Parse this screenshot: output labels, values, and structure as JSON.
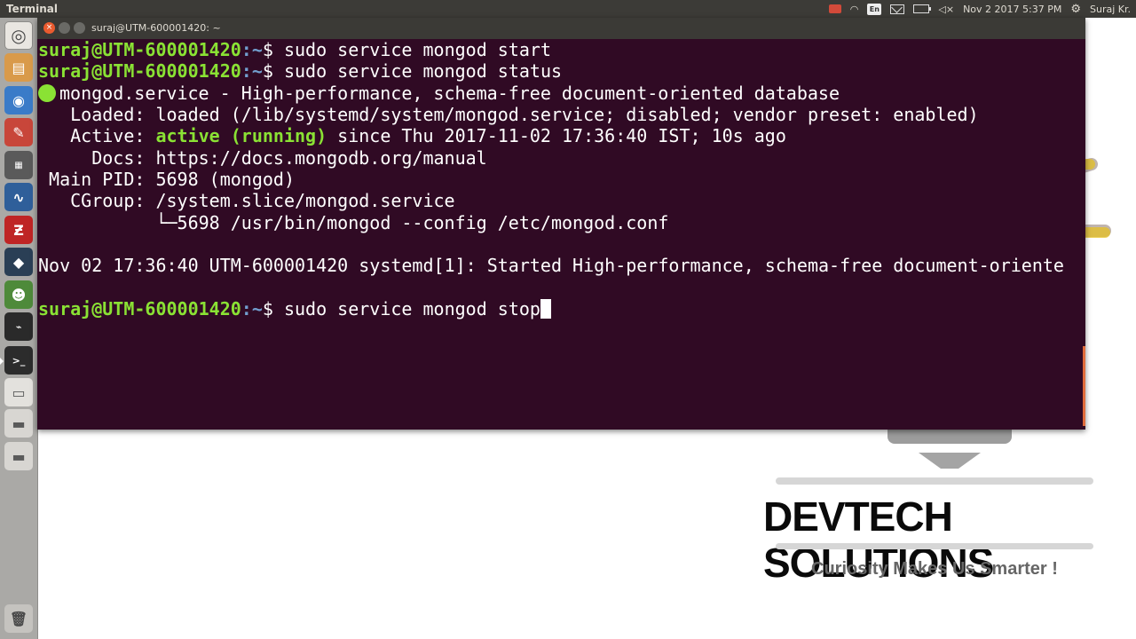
{
  "top_panel": {
    "app_name": "Terminal",
    "keyboard_layout": "En",
    "datetime": "Nov 2 2017 5:37 PM",
    "user": "Suraj Kr."
  },
  "launcher": {
    "items": [
      "dash-home",
      "files",
      "chromium",
      "tools",
      "virtualbox",
      "monitor",
      "filezilla",
      "network",
      "android-studio",
      "system-monitor",
      "terminal",
      "app",
      "drive",
      "drive",
      "trash"
    ]
  },
  "terminal": {
    "title": "suraj@UTM-600001420: ~",
    "prompt_user": "suraj@UTM-600001420",
    "prompt_path": ":~",
    "prompt_symbol": "$ ",
    "cmd1": "sudo service mongod start",
    "cmd2": "sudo service mongod status",
    "status_header": "mongod.service - High-performance, schema-free document-oriented database",
    "loaded": "   Loaded: loaded (/lib/systemd/system/mongod.service; disabled; vendor preset: enabled)",
    "active_prefix": "   Active: ",
    "active_state": "active (running)",
    "active_suffix": " since Thu 2017-11-02 17:36:40 IST; 10s ago",
    "docs": "     Docs: https://docs.mongodb.org/manual",
    "main_pid": " Main PID: 5698 (mongod)",
    "cgroup": "   CGroup: /system.slice/mongod.service",
    "cgroup_proc": "           └─5698 /usr/bin/mongod --config /etc/mongod.conf",
    "log_line": "Nov 02 17:36:40 UTM-600001420 systemd[1]: Started High-performance, schema-free document-oriente",
    "cmd3": "sudo service mongod stop"
  },
  "branding": {
    "title": "DEVTECH SOLUTIONS",
    "tagline": "Curiosity Makes Us Smarter !"
  },
  "colors": {
    "terminal_bg": "#300a24",
    "prompt_green": "#8ae234",
    "prompt_blue": "#729fcf",
    "panel": "#3c3b37"
  }
}
